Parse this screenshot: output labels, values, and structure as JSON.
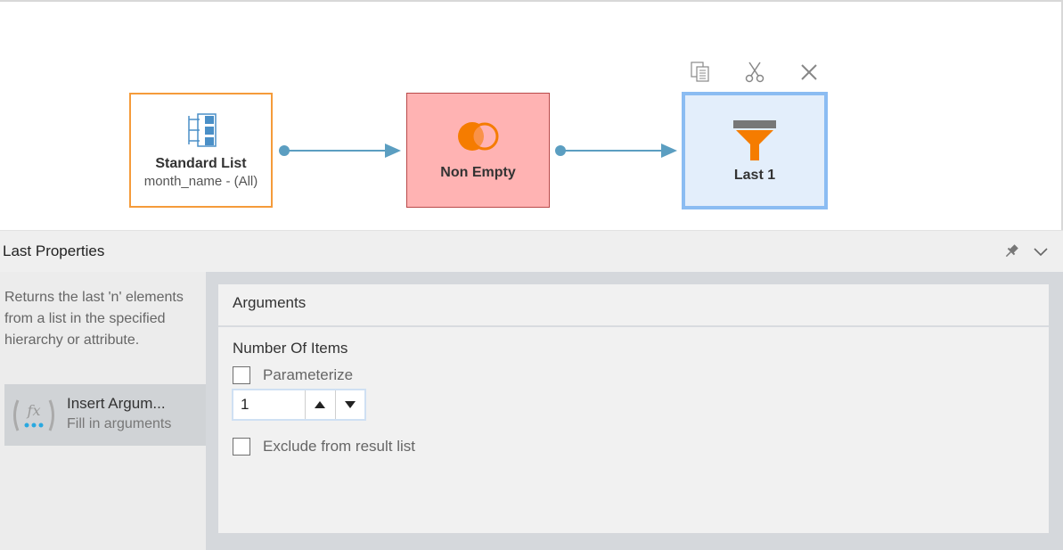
{
  "diagram": {
    "nodes": [
      {
        "title": "Standard List",
        "subtitle": "month_name - (All)",
        "icon": "list-hierarchy-icon"
      },
      {
        "title": "Non Empty",
        "icon": "overlap-circles-icon"
      },
      {
        "title": "Last 1",
        "icon": "filter-funnel-icon"
      }
    ],
    "toolbar_icons": [
      "copy-icon",
      "cut-icon",
      "close-icon"
    ]
  },
  "properties": {
    "title": "Last Properties",
    "header_icons": [
      "pin-icon",
      "chevron-down-icon"
    ],
    "description": "Returns the last 'n' elements from a list in the specified hierarchy or attribute.",
    "insert": {
      "title": "Insert Argum...",
      "subtitle": "Fill in arguments",
      "icon": "function-icon"
    },
    "arguments": {
      "title": "Arguments",
      "number_label": "Number Of Items",
      "parameterize_label": "Parameterize",
      "parameterize_checked": false,
      "value": "1",
      "exclude_label": "Exclude from result list",
      "exclude_checked": false
    }
  },
  "colors": {
    "standard_list_border": "#f59b3a",
    "non_empty_fill": "#ffb3b3",
    "last_fill": "#e3eefb",
    "last_border": "#8bbcf2",
    "connector": "#5b9ec1",
    "accent_orange": "#f57c00"
  }
}
